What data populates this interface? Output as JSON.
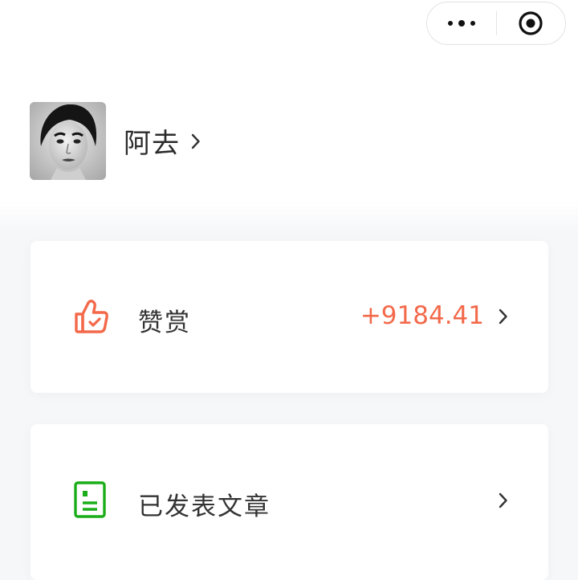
{
  "capsule": {
    "menu_icon": "more-dots-icon",
    "close_icon": "target-close-icon"
  },
  "profile": {
    "name": "阿去",
    "avatar_icon": "avatar-photo",
    "chevron_icon": "chevron-right-icon"
  },
  "cards": {
    "reward": {
      "label": "赞赏",
      "value": "+9184.41",
      "icon": "thumbs-up-icon",
      "icon_color": "#f3694a"
    },
    "articles": {
      "label": "已发表文章",
      "icon": "document-icon",
      "icon_color": "#1aad19"
    }
  },
  "colors": {
    "accent": "#f3694a",
    "green": "#1aad19",
    "text": "#333333",
    "background": "#f6f7f9"
  }
}
